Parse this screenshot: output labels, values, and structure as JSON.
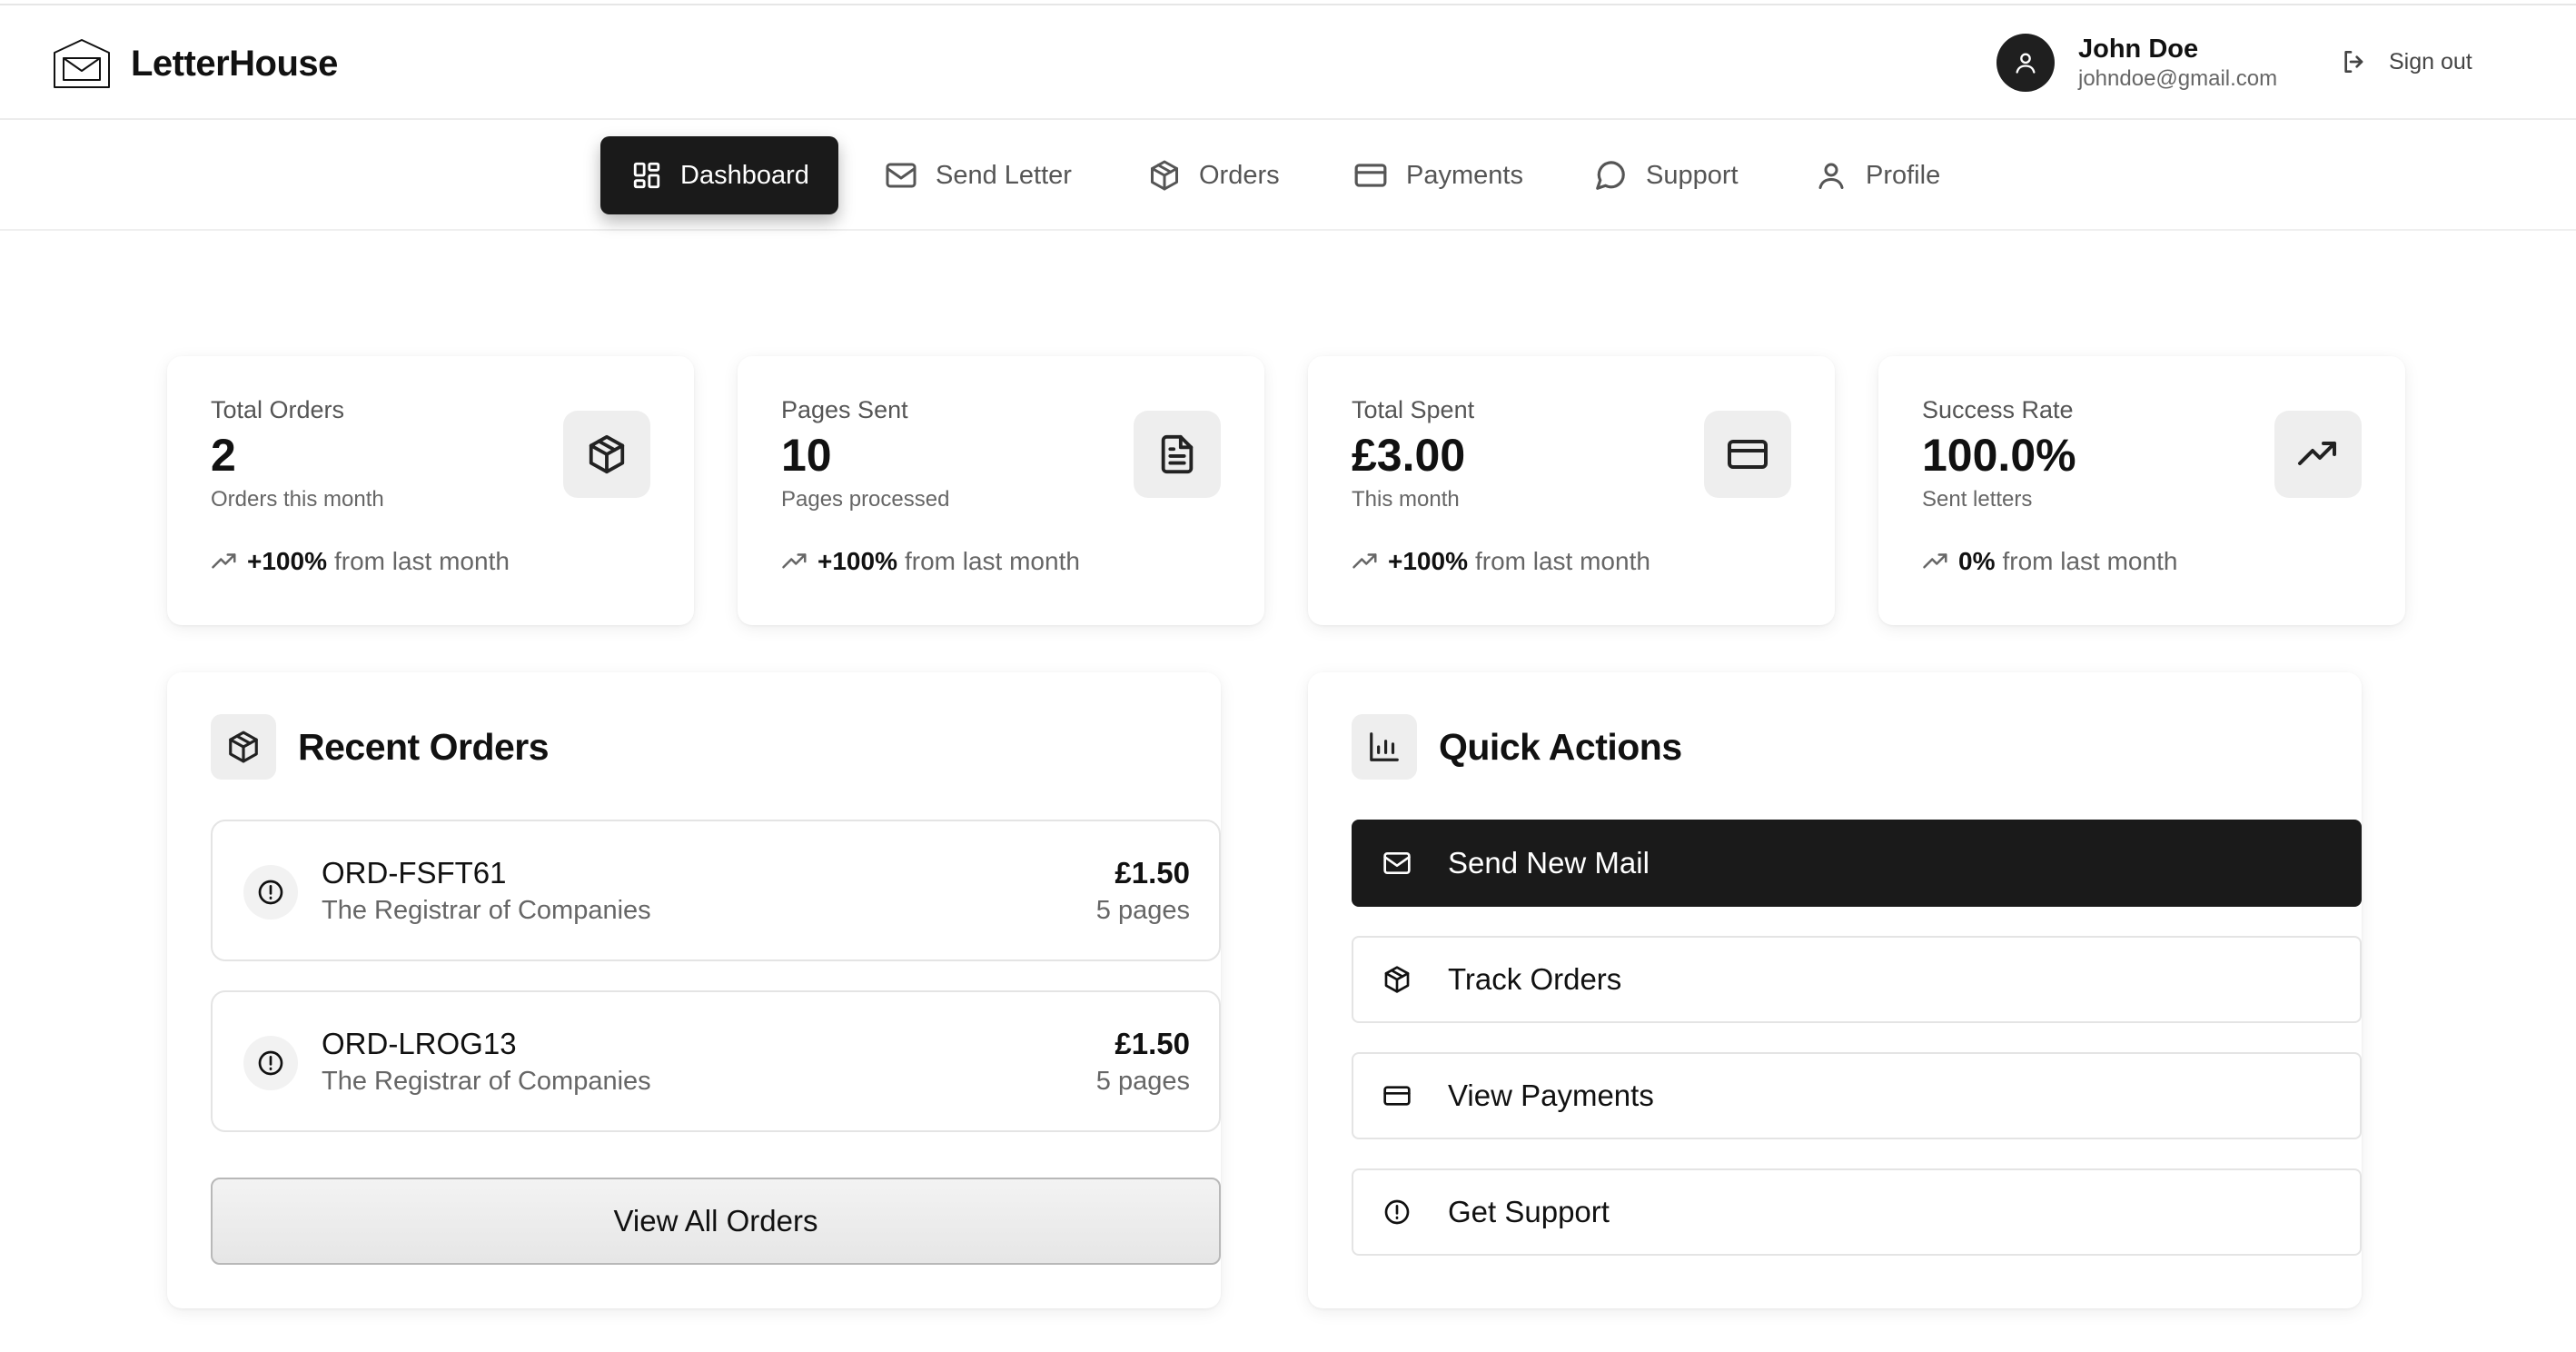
{
  "app": {
    "name": "LetterHouse"
  },
  "user": {
    "name": "John Doe",
    "email": "johndoe@gmail.com",
    "signout_label": "Sign out"
  },
  "nav": {
    "tabs": [
      {
        "label": "Dashboard",
        "icon": "layout-grid-icon",
        "active": true
      },
      {
        "label": "Send Letter",
        "icon": "mail-icon"
      },
      {
        "label": "Orders",
        "icon": "package-icon"
      },
      {
        "label": "Payments",
        "icon": "credit-card-icon"
      },
      {
        "label": "Support",
        "icon": "message-circle-icon"
      },
      {
        "label": "Profile",
        "icon": "user-icon"
      }
    ]
  },
  "stats": [
    {
      "label": "Total Orders",
      "value": "2",
      "sub": "Orders this month",
      "trend": "+100%",
      "trend_suffix": "from last month",
      "icon": "package-icon"
    },
    {
      "label": "Pages Sent",
      "value": "10",
      "sub": "Pages processed",
      "trend": "+100%",
      "trend_suffix": "from last month",
      "icon": "file-text-icon"
    },
    {
      "label": "Total Spent",
      "value": "£3.00",
      "sub": "This month",
      "trend": "+100%",
      "trend_suffix": "from last month",
      "icon": "credit-card-icon"
    },
    {
      "label": "Success Rate",
      "value": "100.0%",
      "sub": "Sent letters",
      "trend": "0%",
      "trend_suffix": "from last month",
      "icon": "trending-up-icon"
    }
  ],
  "recent_orders": {
    "title": "Recent Orders",
    "items": [
      {
        "id": "ORD-FSFT61",
        "recipient": "The Registrar of Companies",
        "price": "£1.50",
        "pages": "5 pages"
      },
      {
        "id": "ORD-LROG13",
        "recipient": "The Registrar of Companies",
        "price": "£1.50",
        "pages": "5 pages"
      }
    ],
    "view_all_label": "View All Orders"
  },
  "quick_actions": {
    "title": "Quick Actions",
    "items": [
      {
        "label": "Send New Mail",
        "icon": "mail-icon",
        "primary": true
      },
      {
        "label": "Track Orders",
        "icon": "package-icon"
      },
      {
        "label": "View Payments",
        "icon": "credit-card-icon"
      },
      {
        "label": "Get Support",
        "icon": "alert-circle-icon"
      }
    ]
  },
  "colors": {
    "primary": "#1a1a1a",
    "muted_text": "#666666",
    "icon_tile": "#eeeeee",
    "border": "#e4e4e4"
  }
}
